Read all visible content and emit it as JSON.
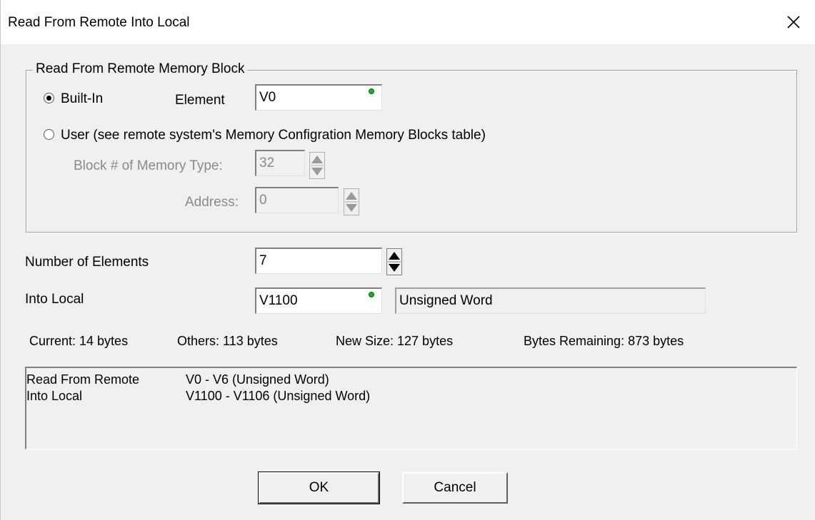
{
  "window": {
    "title": "Read From Remote Into Local",
    "close_icon": "close-icon"
  },
  "remote_block": {
    "legend": "Read From Remote Memory Block",
    "builtin_label": "Built-In",
    "builtin_selected": true,
    "element_label": "Element",
    "element_value": "V0",
    "user_label": "User (see remote system's Memory Configration Memory Blocks table)",
    "block_label": "Block # of Memory Type:",
    "block_value": "32",
    "address_label": "Address:",
    "address_value": "0"
  },
  "num_elements": {
    "label": "Number of Elements",
    "value": "7"
  },
  "into_local": {
    "label": "Into Local",
    "value": "V1100",
    "type": "Unsigned Word"
  },
  "stats": {
    "current": "Current:  14 bytes",
    "others": "Others:  113 bytes",
    "new_size": "New Size:  127 bytes",
    "remaining": "Bytes Remaining:  873 bytes"
  },
  "summary": {
    "rows": [
      {
        "label": "Read From Remote",
        "value": "V0 - V6 (Unsigned Word)"
      },
      {
        "label": "Into Local",
        "value": "V1100 - V1106 (Unsigned Word)"
      }
    ]
  },
  "buttons": {
    "ok": "OK",
    "cancel": "Cancel"
  },
  "colors": {
    "valid_dot": "#22aa22",
    "dialog_bg": "#f0f0f0"
  }
}
